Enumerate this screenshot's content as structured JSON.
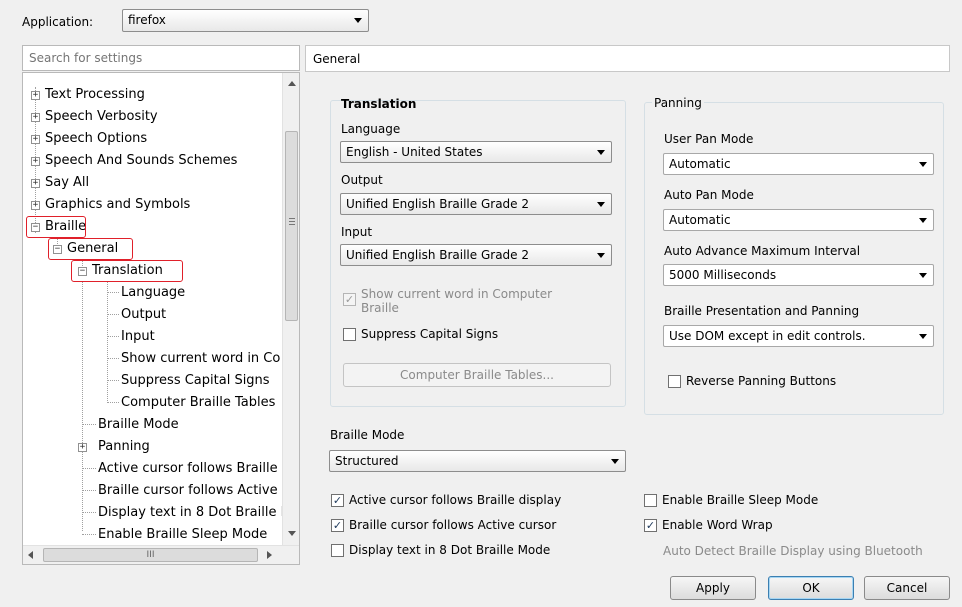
{
  "application": {
    "label": "Application:",
    "value": "firefox"
  },
  "search": {
    "placeholder": "Search for settings"
  },
  "tree": {
    "items": [
      {
        "label": "Text Processing"
      },
      {
        "label": "Speech Verbosity"
      },
      {
        "label": "Speech Options"
      },
      {
        "label": "Speech And Sounds Schemes"
      },
      {
        "label": "Say All"
      },
      {
        "label": "Graphics and Symbols"
      },
      {
        "label": "Braille"
      },
      {
        "label": "General"
      },
      {
        "label": "Translation"
      },
      {
        "label": "Language"
      },
      {
        "label": "Output"
      },
      {
        "label": "Input"
      },
      {
        "label": "Show current word in Co"
      },
      {
        "label": "Suppress Capital Signs"
      },
      {
        "label": "Computer Braille Tables"
      },
      {
        "label": "Braille Mode"
      },
      {
        "label": "Panning"
      },
      {
        "label": "Active cursor follows Braille"
      },
      {
        "label": "Braille cursor follows Active"
      },
      {
        "label": "Display text in 8 Dot Braille M"
      },
      {
        "label": "Enable Braille Sleep Mode"
      }
    ],
    "hscroll_thumb": "III"
  },
  "panel": {
    "title": "General"
  },
  "translation": {
    "title": "Translation",
    "language_label": "Language",
    "language_value": "English - United States",
    "output_label": "Output",
    "output_value": "Unified English Braille Grade 2",
    "input_label": "Input",
    "input_value": "Unified English Braille Grade 2",
    "show_word_line1": "Show current word in Computer",
    "show_word_line2": "Braille",
    "suppress_caps": "Suppress Capital Signs",
    "tables_button": "Computer Braille Tables..."
  },
  "panning": {
    "title": "Panning",
    "user_pan_label": "User Pan Mode",
    "user_pan_value": "Automatic",
    "auto_pan_label": "Auto Pan Mode",
    "auto_pan_value": "Automatic",
    "advance_label": "Auto Advance Maximum Interval",
    "advance_value": "5000 Milliseconds",
    "presentation_label": "Braille Presentation and Panning",
    "presentation_value": "Use DOM except in edit controls.",
    "reverse_label": "Reverse Panning Buttons"
  },
  "braille_mode": {
    "label": "Braille Mode",
    "value": "Structured"
  },
  "options": {
    "active_cursor": "Active cursor follows Braille display",
    "braille_cursor": "Braille cursor follows Active cursor",
    "eight_dot": "Display text in 8 Dot Braille Mode",
    "sleep_mode": "Enable Braille Sleep Mode",
    "word_wrap": "Enable Word Wrap",
    "bluetooth": "Auto Detect Braille Display using Bluetooth"
  },
  "buttons": {
    "apply": "Apply",
    "ok": "OK",
    "cancel": "Cancel"
  },
  "glyphs": {
    "check": "✓",
    "plus": "+",
    "minus": "−"
  }
}
